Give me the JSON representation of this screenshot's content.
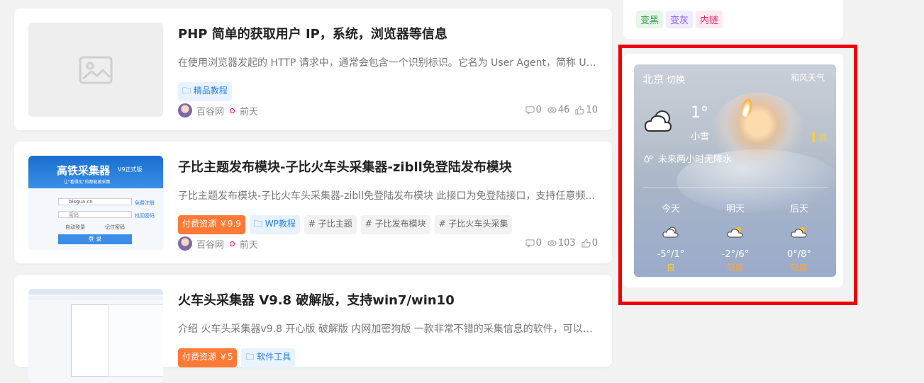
{
  "articles": [
    {
      "title": "PHP 简单的获取用户 IP，系统，浏览器等信息",
      "excerpt": "在使用浏览器发起的 HTTP 请求中，通常会包含一个识别标识。它名为 User Agent，简称 UA...",
      "tags": [
        {
          "label": "精品教程",
          "style": "blue",
          "icon": "folder-icon"
        }
      ],
      "author": "百谷网",
      "time": "前天",
      "comments": "0",
      "views": "46",
      "likes": "10",
      "thumb": "placeholder-image-icon"
    },
    {
      "title": "子比主题发布模块-子比火车头采集器-zibll免登陆发布模块",
      "excerpt": "子比主题发布模块-子比火车头采集器-zibll免登陆发布模块 此接口为免登陆接口，支持任意频...",
      "tags": [
        {
          "label": "付费资源 ￥9.9",
          "style": "orange"
        },
        {
          "label": "WP教程",
          "style": "blue",
          "icon": "folder-icon"
        },
        {
          "label": "# 子比主题",
          "style": "gray"
        },
        {
          "label": "# 子比发布模块",
          "style": "gray"
        },
        {
          "label": "# 子比火车头采集",
          "style": "gray"
        }
      ],
      "author": "百谷网",
      "time": "前天",
      "comments": "0",
      "views": "103",
      "likes": "0",
      "thumb_text": {
        "brand": "高铁采集器",
        "edition": "V9正式版",
        "slogan": "让\"看得见\"的都能被采集",
        "login_field": "bisgua.cn",
        "password_field": "密码",
        "remember": "自动登录",
        "remember2": "记住密码",
        "login_button": "登 录",
        "link1": "免费注册",
        "link2": "找回密码"
      }
    },
    {
      "title": "火车头采集器 V9.8 破解版，支持win7/win10",
      "excerpt": "介绍 火车头采集器v9.8 开心版 破解版 内网加密狗版 一款非常不错的采集信息的软件，可以让...",
      "tags": [
        {
          "label": "付费资源 ￥5",
          "style": "orange"
        },
        {
          "label": "软件工具",
          "style": "blue",
          "icon": "folder-icon"
        }
      ]
    }
  ],
  "sidebar_tags": [
    {
      "label": "变黑",
      "color": "#2f9e44",
      "bg": "#e6f6ea"
    },
    {
      "label": "变灰",
      "color": "#8b5cf6",
      "bg": "#f1ebff"
    },
    {
      "label": "内链",
      "color": "#e0245e",
      "bg": "#ffe9f0"
    }
  ],
  "weather": {
    "city": "北京",
    "switch": "切换",
    "brand": "和风天气",
    "temp": "1°",
    "condition": "小雪",
    "aqi": "良",
    "rain": "未来两小时无降水",
    "forecast": [
      {
        "day": "今天",
        "range": "-5°/1°",
        "quality": "良",
        "q_level": "good",
        "icon": "cloudy-icon"
      },
      {
        "day": "明天",
        "range": "-2°/6°",
        "quality": "轻度",
        "q_level": "light",
        "icon": "partly-sunny-icon"
      },
      {
        "day": "后天",
        "range": "0°/8°",
        "quality": "轻度",
        "q_level": "light",
        "icon": "partly-sunny-icon"
      }
    ]
  }
}
